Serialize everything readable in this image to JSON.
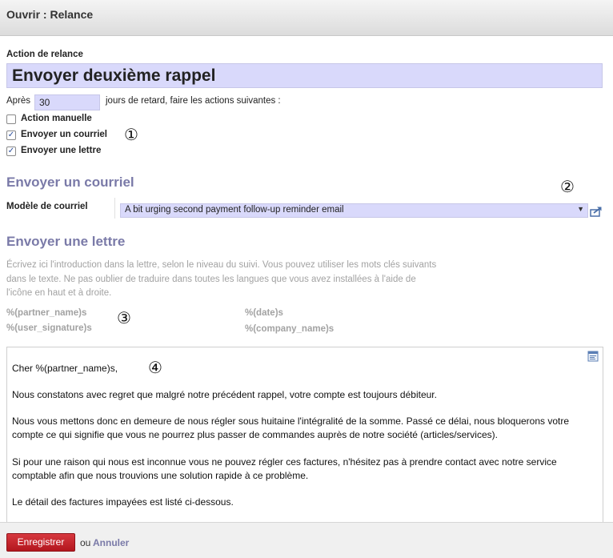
{
  "dialog": {
    "title": "Ouvrir : Relance"
  },
  "form": {
    "name_label": "Action de relance",
    "name_value": "Envoyer deuxième rappel",
    "delay_before": "Après",
    "delay_days": "30",
    "delay_after": "jours de retard, faire les actions suivantes :",
    "options": [
      {
        "label": "Action manuelle",
        "checked": false
      },
      {
        "label": "Envoyer un courriel",
        "checked": true
      },
      {
        "label": "Envoyer une lettre",
        "checked": true
      }
    ]
  },
  "markers": [
    "①",
    "②",
    "③",
    "④"
  ],
  "email_section": {
    "title": "Envoyer un courriel",
    "template_label": "Modèle de courriel",
    "template_value": "A bit urging second payment follow-up reminder email"
  },
  "letter_section": {
    "title": "Envoyer une lettre",
    "help_line_1": "Écrivez ici l'introduction dans la lettre, selon le niveau du suivi. Vous pouvez utiliser les mots clés suivants",
    "help_line_2": "dans le texte. Ne pas oublier de traduire dans toutes les langues que vous avez installées à l'aide de",
    "help_line_3": "l'icône en haut et à droite.",
    "keywords": [
      "%(partner_name)s",
      "%(date)s",
      "%(user_signature)s",
      "%(company_name)s"
    ]
  },
  "editor": {
    "paragraphs": [
      "Cher %(partner_name)s,",
      "Nous constatons avec regret que malgré notre précédent rappel, votre compte est toujours débiteur.",
      " Nous vous mettons donc en demeure de nous régler sous huitaine l'intégralité de la somme. Passé ce délai, nous bloquerons votre compte ce qui signifie que vous ne pourrez plus passer de commandes auprès de notre société (articles/services).",
      "Si pour une raison qui nous est inconnue vous ne pouvez régler ces factures, n'hésitez pas à prendre contact avec notre service comptable afin que nous trouvions une solution rapide à ce problème.",
      "Le détail des factures impayées est listé ci-dessous."
    ]
  },
  "footer": {
    "save_label": "Enregistrer",
    "or_label": "ou",
    "cancel_label": "Annuler"
  }
}
